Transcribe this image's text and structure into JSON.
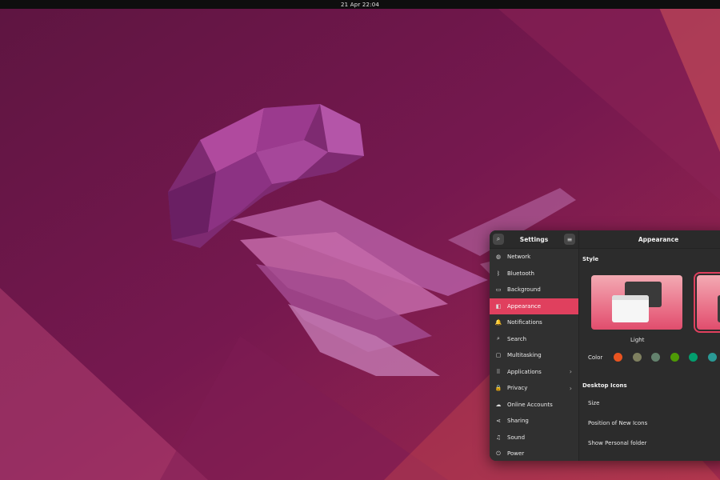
{
  "topbar": {
    "datetime": "21 Apr  22:04"
  },
  "settings": {
    "sidebar_title": "Settings",
    "page_title": "Appearance",
    "nav_items": [
      {
        "label": "Network",
        "icon": "network-icon"
      },
      {
        "label": "Bluetooth",
        "icon": "bluetooth-icon"
      },
      {
        "label": "Background",
        "icon": "background-icon"
      },
      {
        "label": "Appearance",
        "icon": "appearance-icon",
        "active": true
      },
      {
        "label": "Notifications",
        "icon": "bell-icon"
      },
      {
        "label": "Search",
        "icon": "search-icon"
      },
      {
        "label": "Multitasking",
        "icon": "multitasking-icon"
      },
      {
        "label": "Applications",
        "icon": "grid-icon",
        "has_submenu": true
      },
      {
        "label": "Privacy",
        "icon": "lock-icon",
        "has_submenu": true
      },
      {
        "label": "Online Accounts",
        "icon": "cloud-icon"
      },
      {
        "label": "Sharing",
        "icon": "share-icon"
      },
      {
        "label": "Sound",
        "icon": "music-note-icon"
      },
      {
        "label": "Power",
        "icon": "power-icon"
      }
    ],
    "style_section": {
      "label": "Style",
      "options": [
        {
          "label": "Light"
        },
        {
          "label": "",
          "selected": true
        }
      ]
    },
    "color_label": "Color",
    "accent_colors": [
      "#e95420",
      "#7f8060",
      "#64826e",
      "#4e9a06",
      "#039e6e",
      "#2a9a96"
    ],
    "desktop_icons": {
      "label": "Desktop Icons",
      "rows": [
        "Size",
        "Position of New Icons",
        "Show Personal folder"
      ]
    }
  }
}
